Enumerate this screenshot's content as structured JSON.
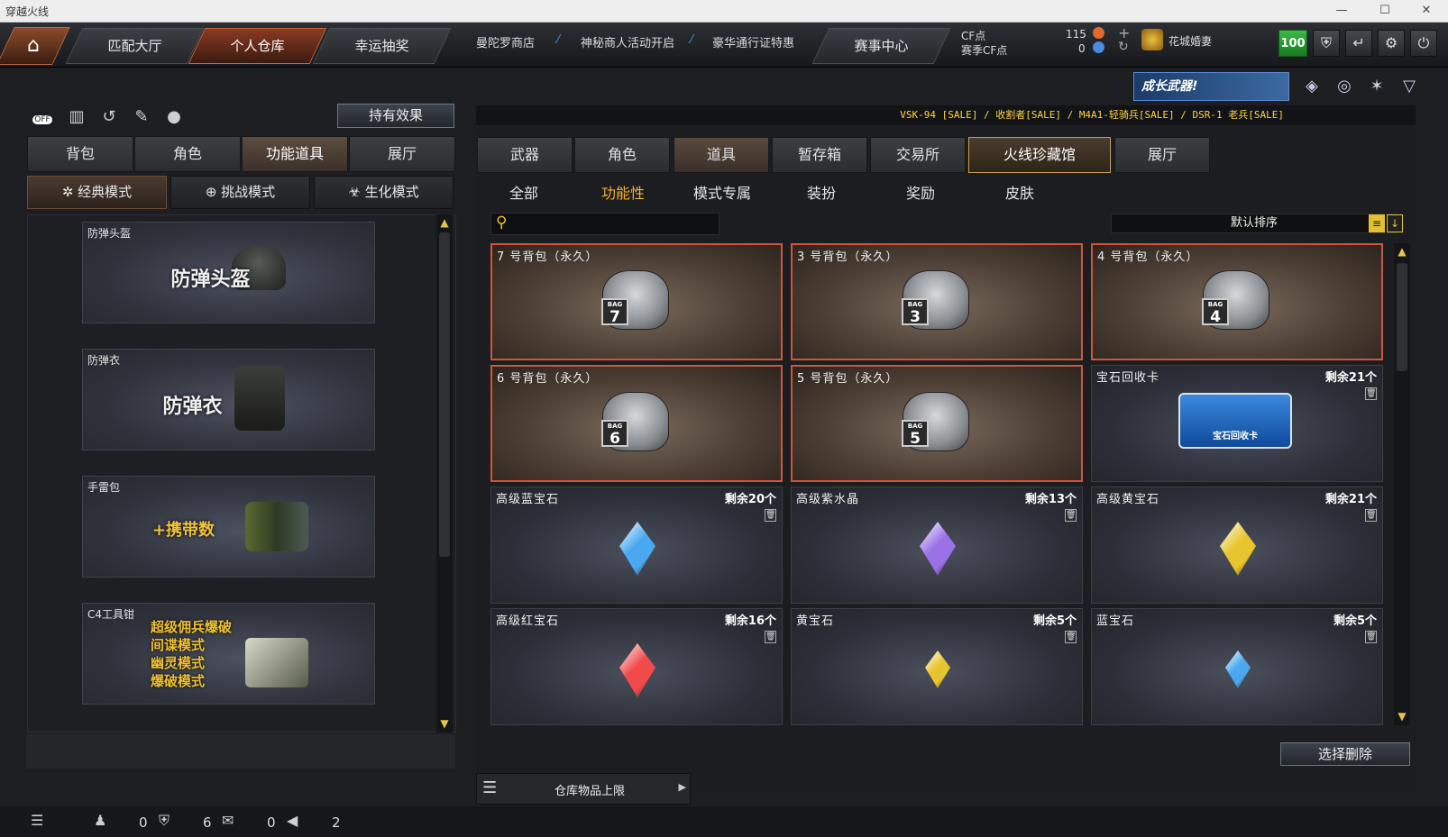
{
  "window": {
    "title": "穿越火线",
    "minimize": "—",
    "maximize": "☐",
    "close": "✕"
  },
  "topnav": {
    "tabs": [
      "匹配大厅",
      "个人仓库",
      "幸运抽奖"
    ],
    "links": [
      "曼陀罗商店",
      "神秘商人活动开启",
      "豪华通行证特惠"
    ],
    "event_tab": "赛事中心",
    "cf_label": "CF点",
    "match_cf_label": "赛季CF点",
    "cf_value": "115",
    "match_cf_value": "0",
    "username": "花城婚妻",
    "level_badge": "100"
  },
  "left": {
    "effect_button": "持有效果",
    "tabs": [
      "背包",
      "角色",
      "功能道具",
      "展厅"
    ],
    "modes": [
      "经典模式",
      "挑战模式",
      "生化模式"
    ],
    "items": [
      {
        "title": "防弹头盔",
        "label": "防弹头盔"
      },
      {
        "title": "防弹衣",
        "label": "防弹衣"
      },
      {
        "title": "手雷包",
        "label": "+携带数"
      },
      {
        "title": "C4工具钳",
        "lines": [
          "超级佣兵爆破",
          "间谍模式",
          "幽灵模式",
          "爆破模式"
        ]
      }
    ]
  },
  "right": {
    "promo": "成长武器!",
    "ticker": "VSK-94 [SALE] / 收割者[SALE] / M4A1-轻骑兵[SALE] / DSR-1 老兵[SALE]",
    "tabs": [
      "武器",
      "角色",
      "道具",
      "暂存箱",
      "交易所",
      "火线珍藏馆",
      "展厅"
    ],
    "subtabs": [
      "全部",
      "功能性",
      "模式专属",
      "装扮",
      "奖励",
      "皮肤"
    ],
    "sort_label": "默认排序",
    "select_delete": "选择删除",
    "capacity_label": "仓库物品上限",
    "items": [
      {
        "name": "7 号背包（永久）",
        "kind": "bag",
        "num": "7",
        "remain": ""
      },
      {
        "name": "3 号背包（永久）",
        "kind": "bag",
        "num": "3",
        "remain": ""
      },
      {
        "name": "4 号背包（永久）",
        "kind": "bag",
        "num": "4",
        "remain": ""
      },
      {
        "name": "6 号背包（永久）",
        "kind": "bag",
        "num": "6",
        "remain": ""
      },
      {
        "name": "5 号背包（永久）",
        "kind": "bag",
        "num": "5",
        "remain": ""
      },
      {
        "name": "宝石回收卡",
        "kind": "card",
        "card_text": "宝石回收卡",
        "remain": "剩余21个"
      },
      {
        "name": "高级蓝宝石",
        "kind": "gem",
        "color": "#4aa8f0",
        "remain": "剩余20个"
      },
      {
        "name": "高级紫水晶",
        "kind": "gem",
        "color": "#9a72e8",
        "remain": "剩余13个"
      },
      {
        "name": "高级黄宝石",
        "kind": "gem",
        "color": "#e8c52e",
        "remain": "剩余21个"
      },
      {
        "name": "高级红宝石",
        "kind": "gem",
        "color": "#f04a4a",
        "remain": "剩余16个"
      },
      {
        "name": "黄宝石",
        "kind": "gem-small",
        "color": "#e8c52e",
        "remain": "剩余5个"
      },
      {
        "name": "蓝宝石",
        "kind": "gem-small",
        "color": "#4aa8f0",
        "remain": "剩余5个"
      }
    ]
  },
  "bottom": {
    "friends": "0",
    "clan": "6",
    "chat": "0",
    "volume": "2"
  },
  "icons": {
    "home": "house-icon",
    "search": "search-icon",
    "shield": "shield-icon",
    "back": "back-icon",
    "settings": "gear-icon",
    "power": "power-icon"
  }
}
